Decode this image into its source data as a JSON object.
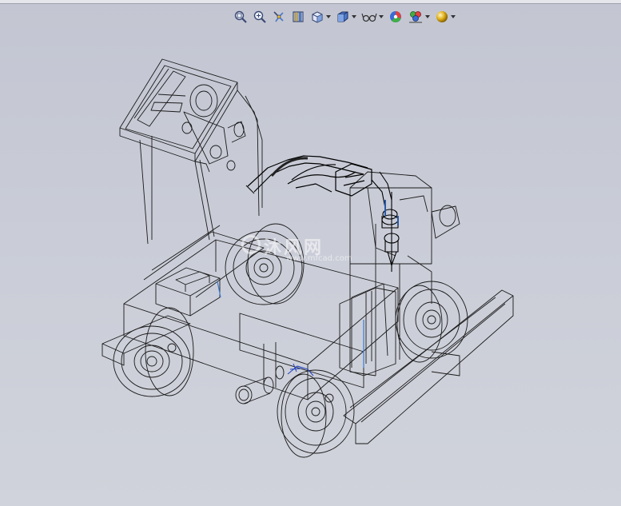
{
  "app": "SolidWorks",
  "heads_up_toolbar": {
    "buttons": [
      {
        "id": "zoom-to-fit",
        "icon": "zoom-to-fit-icon",
        "dropdown": false
      },
      {
        "id": "zoom-to-area",
        "icon": "zoom-to-area-icon",
        "dropdown": false
      },
      {
        "id": "previous-view",
        "icon": "previous-view-icon",
        "dropdown": false
      },
      {
        "id": "section-view",
        "icon": "section-view-icon",
        "dropdown": false
      },
      {
        "id": "view-orientation",
        "icon": "view-orientation-icon",
        "dropdown": true
      },
      {
        "id": "display-style",
        "icon": "display-style-icon",
        "dropdown": true
      },
      {
        "id": "hide-show-items",
        "icon": "hide-show-items-icon",
        "dropdown": true
      },
      {
        "id": "edit-appearance",
        "icon": "edit-appearance-icon",
        "dropdown": false
      },
      {
        "id": "apply-scene",
        "icon": "apply-scene-icon",
        "dropdown": true
      },
      {
        "id": "view-settings",
        "icon": "view-settings-icon",
        "dropdown": true
      }
    ]
  },
  "watermark": {
    "main": "沐风网",
    "sub": "www.mfcad.com"
  },
  "model": {
    "description_icon": "wireframe-cart-model",
    "colors": {
      "line": "#1a1a1a",
      "accent_blue": "#3a7bd5",
      "triad_blue": "#2040c0"
    }
  },
  "colors": {
    "viewport_bg": "#c9ccd6",
    "appearance_red": "#e04040",
    "appearance_green": "#40b040",
    "appearance_blue": "#3a6ad5",
    "scene_gold": "#e2b21a"
  }
}
